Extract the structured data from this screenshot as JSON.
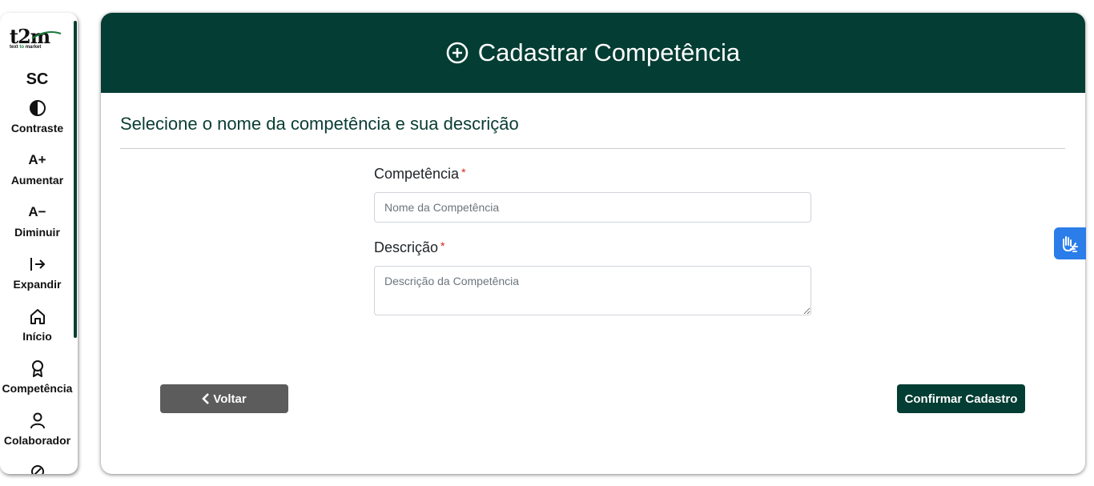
{
  "sidebar": {
    "logo": {
      "main": "t2m",
      "sub_prefix": "text",
      "sub_mid": "to",
      "sub_suffix": "market"
    },
    "org_label": "SC",
    "items": [
      {
        "label": "Contraste",
        "icon": "contrast-icon"
      },
      {
        "label": "Aumentar",
        "icon_text": "A+"
      },
      {
        "label": "Diminuir",
        "icon_text": "A−"
      },
      {
        "label": "Expandir",
        "icon": "expand-icon"
      },
      {
        "label": "Início",
        "icon": "home-icon"
      },
      {
        "label": "Competência",
        "icon": "award-icon"
      },
      {
        "label": "Colaborador",
        "icon": "person-icon"
      },
      {
        "label": "",
        "icon": "tools-icon"
      }
    ]
  },
  "header": {
    "title": "Cadastrar Competência",
    "icon": "plus-circle-icon"
  },
  "form": {
    "section_title": "Selecione o nome da competência e sua descrição",
    "competencia_label": "Competência",
    "competencia_required": "*",
    "competencia_placeholder": "Nome da Competência",
    "descricao_label": "Descrição",
    "descricao_required": "*",
    "descricao_placeholder": "Descrição da Competência"
  },
  "actions": {
    "back_label": "Voltar",
    "confirm_label": "Confirmar Cadastro"
  },
  "colors": {
    "brand_dark": "#033d33",
    "back_button": "#5c5c5c",
    "accessibility_widget": "#2b7de9",
    "required": "#d9201a"
  }
}
